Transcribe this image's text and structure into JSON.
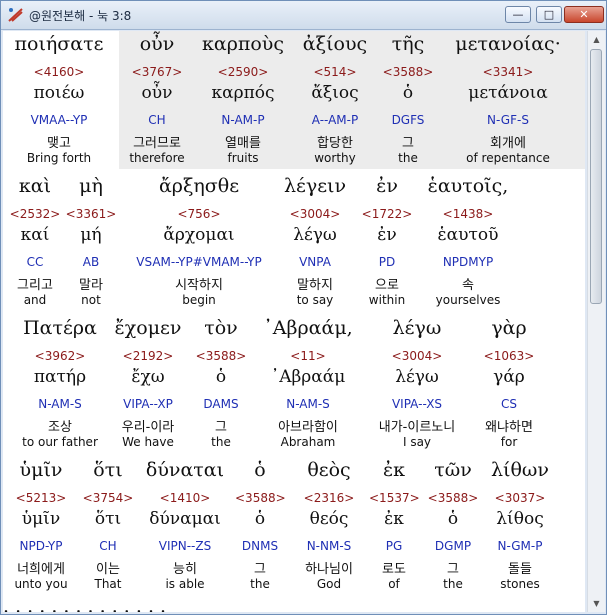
{
  "window": {
    "title": "@원전본해 - 눅 3:8",
    "minimize_label": "—",
    "maximize_label": "□",
    "close_label": "✕"
  },
  "rows": [
    {
      "words": [
        {
          "greek": "ποιήσατε",
          "strong": "<4160>",
          "lemma": "ποιέω",
          "parse": "VMAA--YP",
          "korean": "맺고",
          "english": "Bring forth"
        },
        {
          "greek": "οὖν",
          "strong": "<3767>",
          "lemma": "οὖν",
          "parse": "CH",
          "korean": "그러므로",
          "english": "therefore"
        },
        {
          "greek": "καρποὺς",
          "strong": "<2590>",
          "lemma": "καρπός",
          "parse": "N-AM-P",
          "korean": "열매를",
          "english": "fruits"
        },
        {
          "greek": "ἀξίους",
          "strong": "<514>",
          "lemma": "ἄξιος",
          "parse": "A--AM-P",
          "korean": "합당한",
          "english": "worthy"
        },
        {
          "greek": "τῆς",
          "strong": "<3588>",
          "lemma": "ὁ",
          "parse": "DGFS",
          "korean": "그",
          "english": "the"
        },
        {
          "greek": "μετανοίας·",
          "strong": "<3341>",
          "lemma": "μετάνοια",
          "parse": "N-GF-S",
          "korean": "회개에",
          "english": "of repentance"
        }
      ]
    },
    {
      "words": [
        {
          "greek": "καὶ",
          "strong": "<2532>",
          "lemma": "καί",
          "parse": "CC",
          "korean": "그리고",
          "english": "and"
        },
        {
          "greek": "μὴ",
          "strong": "<3361>",
          "lemma": "μή",
          "parse": "AB",
          "korean": "말라",
          "english": "not"
        },
        {
          "greek": "ἄρξησθε",
          "strong": "<756>",
          "lemma": "ἄρχομαι",
          "parse": "VSAM--YP#VMAM--YP",
          "korean": "시작하지",
          "english": "begin"
        },
        {
          "greek": "λέγειν",
          "strong": "<3004>",
          "lemma": "λέγω",
          "parse": "VNPA",
          "korean": "말하지",
          "english": "to say"
        },
        {
          "greek": "ἐν",
          "strong": "<1722>",
          "lemma": "ἐν",
          "parse": "PD",
          "korean": "으로",
          "english": "within"
        },
        {
          "greek": "ἑαυτοῖς,",
          "strong": "<1438>",
          "lemma": "ἑαυτοῦ",
          "parse": "NPDMYP",
          "korean": "속",
          "english": "yourselves"
        }
      ]
    },
    {
      "words": [
        {
          "greek": "Πατέρα",
          "strong": "<3962>",
          "lemma": "πατήρ",
          "parse": "N-AM-S",
          "korean": "조상",
          "english": "to our father"
        },
        {
          "greek": "ἔχομεν",
          "strong": "<2192>",
          "lemma": "ἔχω",
          "parse": "VIPA--XP",
          "korean": "우리-이라",
          "english": "We have"
        },
        {
          "greek": "τὸν",
          "strong": "<3588>",
          "lemma": "ὁ",
          "parse": "DAMS",
          "korean": "그",
          "english": "the"
        },
        {
          "greek": "᾿Αβραάμ,",
          "strong": "<11>",
          "lemma": "᾿Αβραάμ",
          "parse": "N-AM-S",
          "korean": "아브라함이",
          "english": "Abraham"
        },
        {
          "greek": "λέγω",
          "strong": "<3004>",
          "lemma": "λέγω",
          "parse": "VIPA--XS",
          "korean": "내가-이르노니",
          "english": "I say"
        },
        {
          "greek": "γὰρ",
          "strong": "<1063>",
          "lemma": "γάρ",
          "parse": "CS",
          "korean": "왜냐하면",
          "english": "for"
        }
      ]
    },
    {
      "words": [
        {
          "greek": "ὑμῖν",
          "strong": "<5213>",
          "lemma": "ὑμῖν",
          "parse": "NPD-YP",
          "korean": "너희에게",
          "english": "unto you"
        },
        {
          "greek": "ὅτι",
          "strong": "<3754>",
          "lemma": "ὅτι",
          "parse": "CH",
          "korean": "이는",
          "english": "That"
        },
        {
          "greek": "δύναται",
          "strong": "<1410>",
          "lemma": "δύναμαι",
          "parse": "VIPN--ZS",
          "korean": "능히",
          "english": "is able"
        },
        {
          "greek": "ὁ",
          "strong": "<3588>",
          "lemma": "ὁ",
          "parse": "DNMS",
          "korean": "그",
          "english": "the"
        },
        {
          "greek": "θεὸς",
          "strong": "<2316>",
          "lemma": "θεός",
          "parse": "N-NM-S",
          "korean": "하나님이",
          "english": "God"
        },
        {
          "greek": "ἐκ",
          "strong": "<1537>",
          "lemma": "ἐκ",
          "parse": "PG",
          "korean": "로도",
          "english": "of"
        },
        {
          "greek": "τῶν",
          "strong": "<3588>",
          "lemma": "ὁ",
          "parse": "DGMP",
          "korean": "그",
          "english": "the"
        },
        {
          "greek": "λίθων",
          "strong": "<3037>",
          "lemma": "λίθος",
          "parse": "N-GM-P",
          "korean": "돌들",
          "english": "stones"
        }
      ]
    }
  ],
  "colors": {
    "strong": "#8b1a1a",
    "parse": "#1f2fb4",
    "text": "#111111"
  }
}
